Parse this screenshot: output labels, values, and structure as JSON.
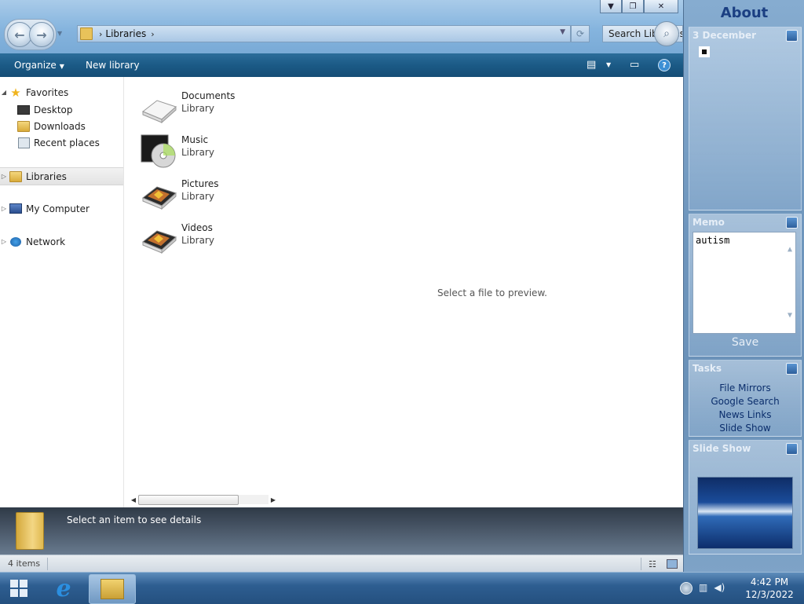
{
  "explorer": {
    "address": {
      "segment": "Libraries"
    },
    "search_placeholder": "Search Libraries",
    "toolbar": {
      "organize": "Organize",
      "new_library": "New library"
    },
    "navpane": {
      "favorites": "Favorites",
      "desktop": "Desktop",
      "downloads": "Downloads",
      "recent": "Recent places",
      "libraries": "Libraries",
      "computer": "My Computer",
      "network": "Network"
    },
    "libraries": [
      {
        "name": "Documents",
        "type": "Library"
      },
      {
        "name": "Music",
        "type": "Library"
      },
      {
        "name": "Pictures",
        "type": "Library"
      },
      {
        "name": "Videos",
        "type": "Library"
      }
    ],
    "preview_message": "Select a file to preview.",
    "details_message": "Select an item to see details",
    "status_count": "4 items"
  },
  "sidebar": {
    "about": "About",
    "calendar_date": "3 December",
    "memo_title": "Memo",
    "memo_text": "autism",
    "memo_save": "Save",
    "tasks_title": "Tasks",
    "tasks": [
      "File Mirrors",
      "Google Search",
      "News Links",
      "Slide Show"
    ],
    "slideshow_title": "Slide Show"
  },
  "taskbar": {
    "time": "4:42 PM",
    "date": "12/3/2022"
  },
  "colors": {
    "toolbar": "#1b5a86",
    "sidebar": "#6f96bd",
    "taskbar": "#2e5e91",
    "memo_link": "#0b2e6c"
  }
}
